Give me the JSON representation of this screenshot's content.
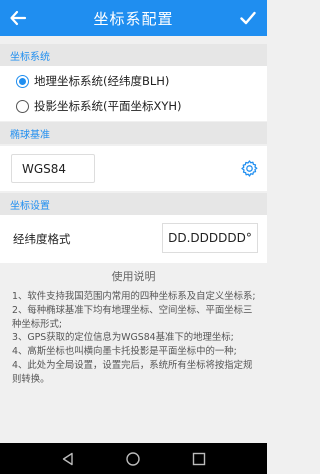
{
  "header": {
    "title": "坐标系配置",
    "back_icon": "arrow-left-icon",
    "confirm_icon": "check-icon"
  },
  "coord_system": {
    "section_title": "坐标系统",
    "options": [
      {
        "label": "地理坐标系统(经纬度BLH)",
        "selected": true
      },
      {
        "label": "投影坐标系统(平面坐标XYH)",
        "selected": false
      }
    ]
  },
  "ellipsoid": {
    "section_title": "椭球基准",
    "value": "WGS84",
    "settings_icon": "gear-icon"
  },
  "coord_settings": {
    "section_title": "坐标设置",
    "format_label": "经纬度格式",
    "format_value": "DD.DDDDDD°"
  },
  "help": {
    "title": "使用说明",
    "items": [
      "1、软件支持我国范围内常用的四种坐标系及自定义坐标系;",
      "2、每种椭球基准下均有地理坐标、空间坐标、平面坐标三种坐标形式;",
      "3、GPS获取的定位信息为WGS84基准下的地理坐标;",
      "4、高斯坐标也叫横向墨卡托投影是平面坐标中的一种;",
      "4、此处为全局设置，设置完后，系统所有坐标将按指定规则转换。"
    ]
  },
  "system_nav": {
    "icons": [
      "back-triangle-icon",
      "home-circle-icon",
      "recents-square-icon"
    ]
  },
  "colors": {
    "accent": "#1f8ef0",
    "section_bg": "#e6e6e6"
  }
}
